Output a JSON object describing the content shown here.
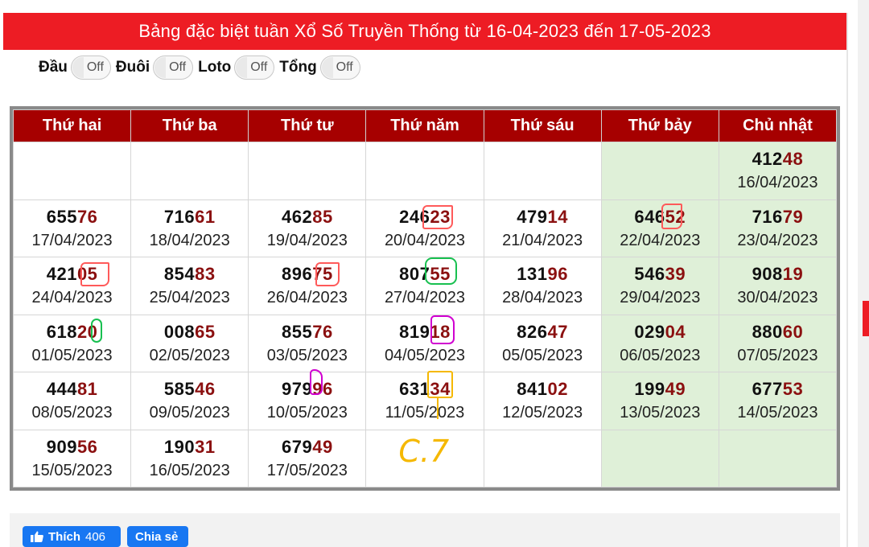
{
  "title": "Bảng đặc biệt tuần Xổ Số Truyền Thống từ 16-04-2023 đến 17-05-2023",
  "toggles": [
    {
      "label": "Đầu",
      "state": "Off"
    },
    {
      "label": "Đuôi",
      "state": "Off"
    },
    {
      "label": "Loto",
      "state": "Off"
    },
    {
      "label": "Tổng",
      "state": "Off"
    }
  ],
  "headers": [
    "Thứ hai",
    "Thứ ba",
    "Thứ tư",
    "Thứ năm",
    "Thứ sáu",
    "Thứ bảy",
    "Chủ nhật"
  ],
  "weeks": [
    [
      null,
      null,
      null,
      null,
      null,
      null,
      {
        "head": "412",
        "tail": "48",
        "date": "16/04/2023"
      }
    ],
    [
      {
        "head": "655",
        "tail": "76",
        "date": "17/04/2023"
      },
      {
        "head": "716",
        "tail": "61",
        "date": "18/04/2023"
      },
      {
        "head": "462",
        "tail": "85",
        "date": "19/04/2023"
      },
      {
        "head": "246",
        "tail": "23",
        "date": "20/04/2023"
      },
      {
        "head": "479",
        "tail": "14",
        "date": "21/04/2023"
      },
      {
        "head": "646",
        "tail": "52",
        "date": "22/04/2023"
      },
      {
        "head": "716",
        "tail": "79",
        "date": "23/04/2023"
      }
    ],
    [
      {
        "head": "421",
        "tail": "05",
        "date": "24/04/2023"
      },
      {
        "head": "854",
        "tail": "83",
        "date": "25/04/2023"
      },
      {
        "head": "896",
        "tail": "75",
        "date": "26/04/2023"
      },
      {
        "head": "807",
        "tail": "55",
        "date": "27/04/2023"
      },
      {
        "head": "131",
        "tail": "96",
        "date": "28/04/2023"
      },
      {
        "head": "546",
        "tail": "39",
        "date": "29/04/2023"
      },
      {
        "head": "908",
        "tail": "19",
        "date": "30/04/2023"
      }
    ],
    [
      {
        "head": "618",
        "tail": "20",
        "date": "01/05/2023"
      },
      {
        "head": "008",
        "tail": "65",
        "date": "02/05/2023"
      },
      {
        "head": "855",
        "tail": "76",
        "date": "03/05/2023"
      },
      {
        "head": "819",
        "tail": "18",
        "date": "04/05/2023"
      },
      {
        "head": "826",
        "tail": "47",
        "date": "05/05/2023"
      },
      {
        "head": "029",
        "tail": "04",
        "date": "06/05/2023"
      },
      {
        "head": "880",
        "tail": "60",
        "date": "07/05/2023"
      }
    ],
    [
      {
        "head": "444",
        "tail": "81",
        "date": "08/05/2023"
      },
      {
        "head": "585",
        "tail": "46",
        "date": "09/05/2023"
      },
      {
        "head": "979",
        "tail": "96",
        "date": "10/05/2023"
      },
      {
        "head": "631",
        "tail": "34",
        "date": "11/05/2023"
      },
      {
        "head": "841",
        "tail": "02",
        "date": "12/05/2023"
      },
      {
        "head": "199",
        "tail": "49",
        "date": "13/05/2023"
      },
      {
        "head": "677",
        "tail": "53",
        "date": "14/05/2023"
      }
    ],
    [
      {
        "head": "909",
        "tail": "56",
        "date": "15/05/2023"
      },
      {
        "head": "190",
        "tail": "31",
        "date": "16/05/2023"
      },
      {
        "head": "679",
        "tail": "49",
        "date": "17/05/2023"
      },
      null,
      null,
      null,
      null
    ]
  ],
  "handwritten_note": "C.7",
  "social": {
    "like_label": "Thích",
    "like_count": "406",
    "share_label": "Chia sẻ"
  },
  "colors": {
    "title_bar": "#ed1c24",
    "header_bg": "#a60000",
    "weekend_bg": "#dff0d8",
    "tail_digits": "#8b1010",
    "facebook": "#1877f2"
  },
  "icons": [
    "thumbs-up-icon"
  ]
}
